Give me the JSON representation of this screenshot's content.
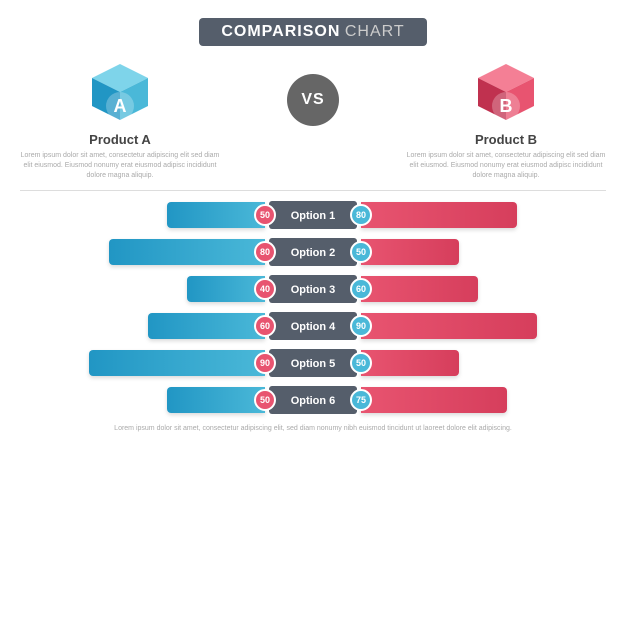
{
  "title": {
    "main": "COMPARISON",
    "sub": "CHART"
  },
  "products": {
    "a": {
      "name": "Product A",
      "desc": "Lorem ipsum dolor sit amet, consectetur adipiscing elit sed diam elit eiusmod. Eiusmod nonumy erat eiusmod adipisc incididunt dolore magna aliquip."
    },
    "vs": "VS",
    "b": {
      "name": "Product B",
      "desc": "Lorem ipsum dolor sit amet, consectetur adipiscing elit sed diam elit eiusmod. Eiusmod nonumy erat eiusmod adipisc incididunt dolore magna aliquip."
    }
  },
  "options": [
    {
      "label": "Option 1",
      "valueA": 50,
      "valueB": 80
    },
    {
      "label": "Option 2",
      "valueA": 80,
      "valueB": 50
    },
    {
      "label": "Option 3",
      "valueA": 40,
      "valueB": 60
    },
    {
      "label": "Option 4",
      "valueA": 60,
      "valueB": 90
    },
    {
      "label": "Option 5",
      "valueA": 90,
      "valueB": 50
    },
    {
      "label": "Option 6",
      "valueA": 50,
      "valueB": 75
    }
  ],
  "footer": "Lorem ipsum dolor sit amet, consectetur adipiscing elit, sed diam nonumy nibh euismod tincidunt ut laoreet dolore elit adipiscing."
}
